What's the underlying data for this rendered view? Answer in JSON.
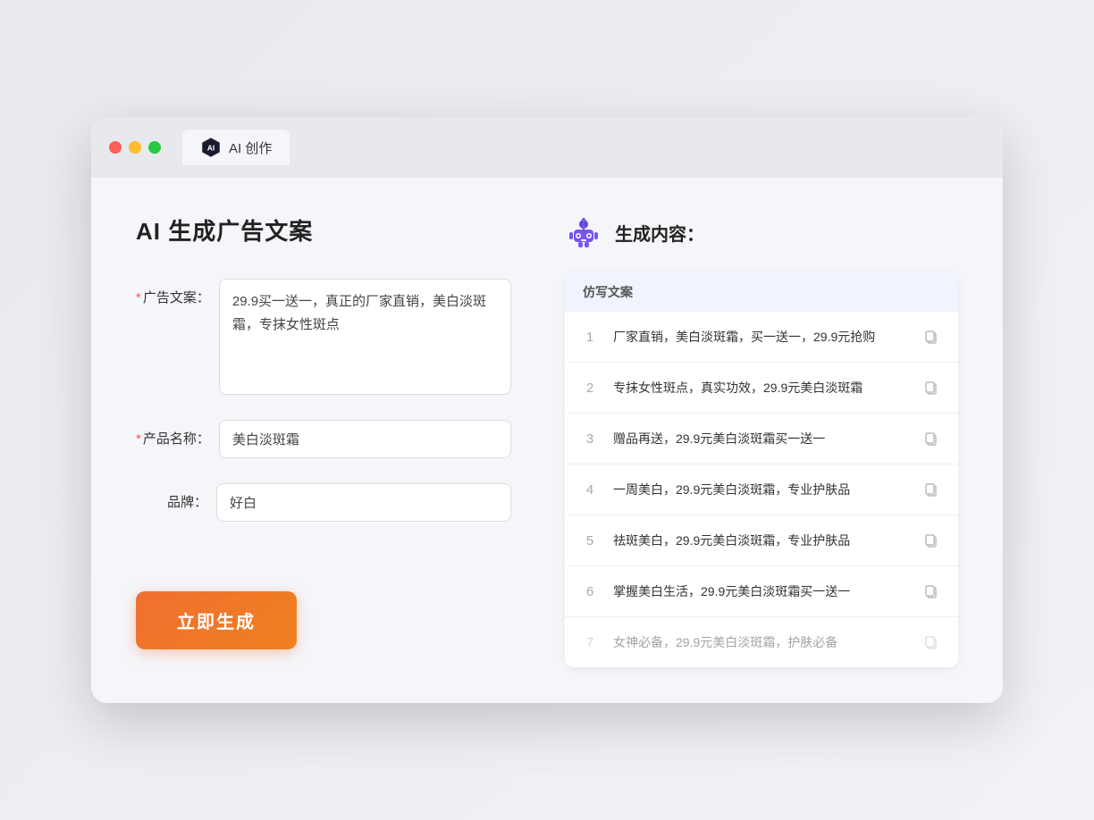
{
  "window": {
    "tab_label": "AI 创作"
  },
  "left_panel": {
    "title": "AI 生成广告文案",
    "ad_copy_label": "广告文案：",
    "ad_copy_required": true,
    "ad_copy_value": "29.9买一送一，真正的厂家直销，美白淡斑霜，专抹女性斑点",
    "product_name_label": "产品名称：",
    "product_name_required": true,
    "product_name_value": "美白淡斑霜",
    "brand_label": "品牌：",
    "brand_required": false,
    "brand_value": "好白",
    "generate_btn_label": "立即生成"
  },
  "right_panel": {
    "title": "生成内容：",
    "table_header": "仿写文案",
    "results": [
      {
        "num": "1",
        "text": "厂家直销，美白淡斑霜，买一送一，29.9元抢购",
        "faded": false
      },
      {
        "num": "2",
        "text": "专抹女性斑点，真实功效，29.9元美白淡斑霜",
        "faded": false
      },
      {
        "num": "3",
        "text": "赠品再送，29.9元美白淡斑霜买一送一",
        "faded": false
      },
      {
        "num": "4",
        "text": "一周美白，29.9元美白淡斑霜，专业护肤品",
        "faded": false
      },
      {
        "num": "5",
        "text": "祛斑美白，29.9元美白淡斑霜，专业护肤品",
        "faded": false
      },
      {
        "num": "6",
        "text": "掌握美白生活，29.9元美白淡斑霜买一送一",
        "faded": false
      },
      {
        "num": "7",
        "text": "女神必备，29.9元美白淡斑霜，护肤必备",
        "faded": true
      }
    ]
  },
  "colors": {
    "accent": "#f07030",
    "required": "#ff5555"
  }
}
